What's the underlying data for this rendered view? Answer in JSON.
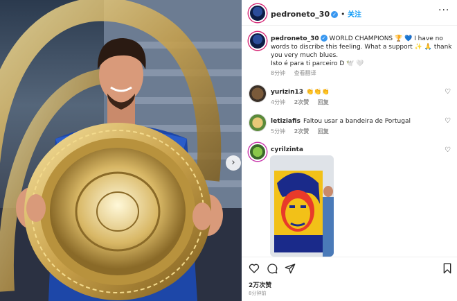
{
  "post": {
    "username": "pedroneto_30",
    "follow_label": "关注",
    "caption_username": "pedroneto_30",
    "caption_text": "WORLD CHAMPIONS 🏆 💙 I have no words to discribe this feeling. What a support ✨ 🙏 thank you very much blues.",
    "caption_line2": "Isto é para ti parceiro D 🕊️ 🤍",
    "caption_time": "8分钟",
    "caption_translate": "查看翻译",
    "likes": "2万次赞",
    "time_ago": "8分钟前"
  },
  "comments": [
    {
      "username": "yurizin13",
      "text": "👏👏👏",
      "time": "4分钟",
      "likes": "2次赞",
      "reply": "回复"
    },
    {
      "username": "letiziafis",
      "text": "Faltou usar a bandeira de Portugal",
      "time": "5分钟",
      "likes": "2次赞",
      "reply": "回复"
    },
    {
      "username": "cyrilzinta",
      "text": ""
    }
  ],
  "icons": [
    "more-options-icon",
    "verified-badge-icon",
    "heart-icon",
    "comment-icon",
    "share-icon",
    "bookmark-icon",
    "next-arrow-icon"
  ],
  "colors": {
    "accent": "#0095f6",
    "verified": "#3897f0",
    "muted": "#8e8e8e",
    "text": "#262626"
  }
}
